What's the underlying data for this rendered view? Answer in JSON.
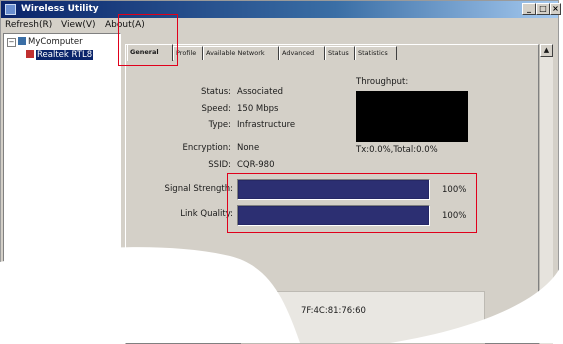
{
  "window": {
    "title": "Wireless Utility",
    "controls": [
      "_",
      "□",
      "×"
    ]
  },
  "menu": [
    {
      "label": "Refresh(R)"
    },
    {
      "label": "View(V)"
    },
    {
      "label": "About(A)"
    }
  ],
  "tree": {
    "root": "MyComputer",
    "device": "Realtek RTL8"
  },
  "tabs": [
    {
      "label": "General"
    },
    {
      "label": "Profile"
    },
    {
      "label": "Available Network"
    },
    {
      "label": "Advanced"
    },
    {
      "label": "Status"
    },
    {
      "label": "Statistics"
    }
  ],
  "general": {
    "status_label": "Status:",
    "status_value": "Associated",
    "speed_label": "Speed:",
    "speed_value": "150 Mbps",
    "type_label": "Type:",
    "type_value": "Infrastructure",
    "encryption_label": "Encryption:",
    "encryption_value": "None",
    "ssid_label": "SSID:",
    "ssid_value": "CQR-980",
    "throughput_label": "Throughput:",
    "throughput_value": "Tx:0.0%,Total:0.0%",
    "signal_label": "Signal Strength:",
    "signal_pct": "100%",
    "signal_level": 100,
    "link_label": "Link Quality:",
    "link_pct": "100%",
    "link_level": 100,
    "mac_partial": "7F:4C:81:76:60"
  },
  "colors": {
    "highlight_border": "#e0001b",
    "bar_fill": "#2c2f72",
    "graph_bg": "#000000"
  }
}
